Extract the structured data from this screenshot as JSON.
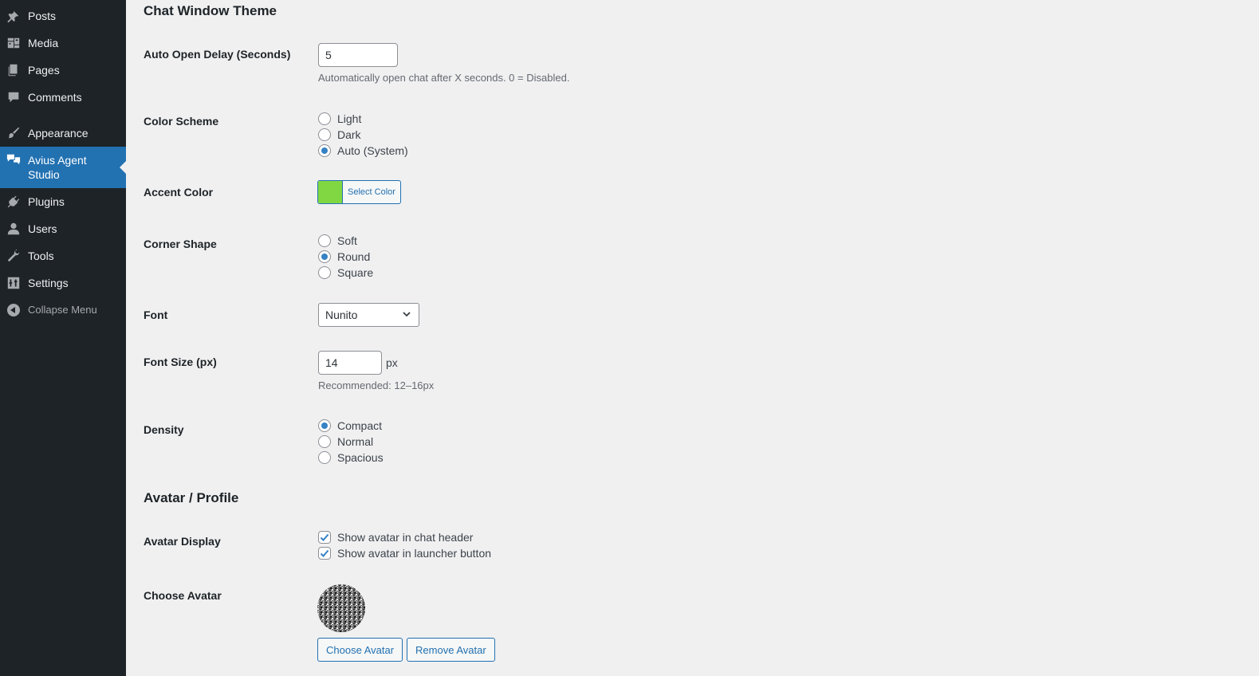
{
  "sidebar": {
    "items": [
      {
        "label": "Posts",
        "icon": "pushpin-icon"
      },
      {
        "label": "Media",
        "icon": "media-icon"
      },
      {
        "label": "Pages",
        "icon": "pages-icon"
      },
      {
        "label": "Comments",
        "icon": "comment-icon"
      },
      {
        "label": "Appearance",
        "icon": "paintbrush-icon"
      },
      {
        "label": "Avius Agent Studio",
        "icon": "chat-bubbles-icon",
        "current": true
      },
      {
        "label": "Plugins",
        "icon": "plugin-icon"
      },
      {
        "label": "Users",
        "icon": "user-icon"
      },
      {
        "label": "Tools",
        "icon": "wrench-icon"
      },
      {
        "label": "Settings",
        "icon": "sliders-icon"
      }
    ],
    "collapse_label": "Collapse Menu"
  },
  "chat_theme": {
    "title": "Chat Window Theme",
    "auto_open": {
      "label": "Auto Open Delay (Seconds)",
      "value": "5",
      "description": "Automatically open chat after X seconds. 0 = Disabled."
    },
    "color_scheme": {
      "label": "Color Scheme",
      "options": [
        "Light",
        "Dark",
        "Auto (System)"
      ],
      "selected": "Auto (System)"
    },
    "accent_color": {
      "label": "Accent Color",
      "button_label": "Select Color",
      "color": "#81d742"
    },
    "corner_shape": {
      "label": "Corner Shape",
      "options": [
        "Soft",
        "Round",
        "Square"
      ],
      "selected": "Round"
    },
    "font": {
      "label": "Font",
      "value": "Nunito"
    },
    "font_size": {
      "label": "Font Size (px)",
      "value": "14",
      "unit": "px",
      "description": "Recommended: 12–16px"
    },
    "density": {
      "label": "Density",
      "options": [
        "Compact",
        "Normal",
        "Spacious"
      ],
      "selected": "Compact"
    }
  },
  "avatar": {
    "title": "Avatar / Profile",
    "display": {
      "label": "Avatar Display",
      "options": [
        {
          "label": "Show avatar in chat header",
          "checked": true
        },
        {
          "label": "Show avatar in launcher button",
          "checked": true
        }
      ]
    },
    "choose": {
      "label": "Choose Avatar",
      "choose_button": "Choose Avatar",
      "remove_button": "Remove Avatar"
    }
  },
  "colors": {
    "sidebar_bg": "#1d2327",
    "accent_blue": "#2271b1",
    "page_bg": "#f0f0f1"
  }
}
